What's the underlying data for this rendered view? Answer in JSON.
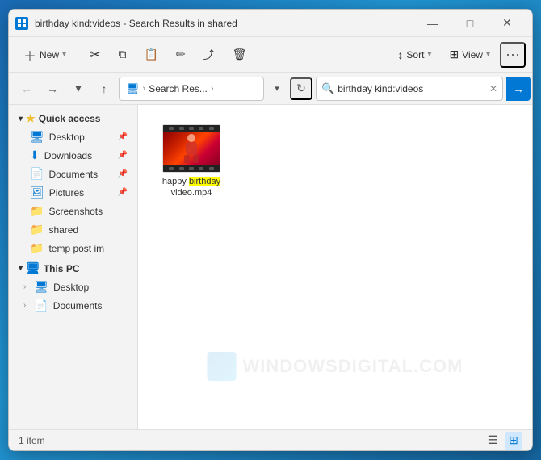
{
  "window": {
    "title": "birthday kind:videos - Search Results in shared",
    "icon": "folder"
  },
  "titleControls": {
    "minimize": "—",
    "maximize": "□",
    "close": "✕"
  },
  "toolbar": {
    "new_label": "New",
    "cut_icon": "✂",
    "copy_icon": "⧉",
    "paste_icon": "📋",
    "rename_icon": "✏",
    "share_icon": "⤴",
    "delete_icon": "🗑",
    "sort_label": "Sort",
    "view_label": "View",
    "more_icon": "···"
  },
  "addressBar": {
    "back_title": "Back",
    "forward_title": "Forward",
    "recent_title": "Recent",
    "up_title": "Up",
    "path_icon": "🖥",
    "path_label": "Search Res...",
    "path_chevron": ">",
    "search_value": "birthday kind:videos",
    "refresh_title": "Refresh"
  },
  "sidebar": {
    "quickAccess": {
      "label": "Quick access",
      "expanded": true,
      "items": [
        {
          "name": "Desktop",
          "icon": "🖥",
          "pinned": true
        },
        {
          "name": "Downloads",
          "icon": "⬇",
          "pinned": true
        },
        {
          "name": "Documents",
          "icon": "📄",
          "pinned": true
        },
        {
          "name": "Pictures",
          "icon": "🖼",
          "pinned": true
        },
        {
          "name": "Screenshots",
          "icon": "📁",
          "pinned": false
        },
        {
          "name": "shared",
          "icon": "📁",
          "pinned": false
        },
        {
          "name": "temp post im",
          "icon": "📁",
          "pinned": false
        }
      ]
    },
    "thisPC": {
      "label": "This PC",
      "expanded": true,
      "items": [
        {
          "name": "Desktop",
          "icon": "🖥",
          "hasChildren": false
        },
        {
          "name": "Documents",
          "icon": "📄",
          "hasChildren": false
        }
      ]
    }
  },
  "files": [
    {
      "name_prefix": "happy ",
      "name_highlight": "birthday",
      "name_suffix": "\nvideo.mp4",
      "type": "video"
    }
  ],
  "statusBar": {
    "item_count": "1 item",
    "list_view_icon": "☰",
    "grid_view_icon": "⊞"
  },
  "watermark": {
    "text": "WINDOWSDIGITAL.COM"
  }
}
